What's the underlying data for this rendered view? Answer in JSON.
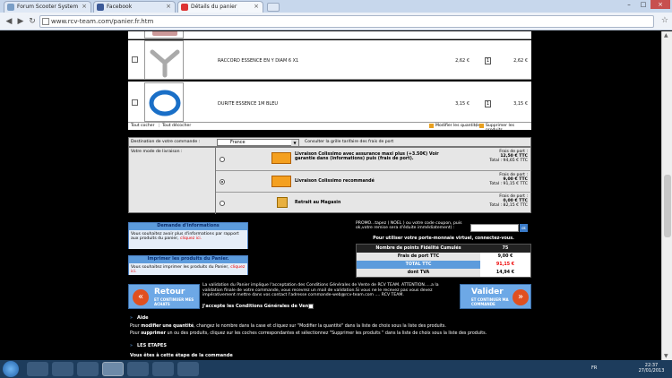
{
  "browser": {
    "tabs": [
      {
        "label": "Forum Scooter System"
      },
      {
        "label": "Facebook"
      },
      {
        "label": "Détails du panier"
      }
    ],
    "url": "www.rcv-team.com/panier.fr.htm"
  },
  "cart": {
    "items": [
      {
        "name": "RACCORD ESSENCE EN Y DIAM 6 X1",
        "unit_price": "2,62 €",
        "qty": "1",
        "total": "2,62 €"
      },
      {
        "name": "DURITE ESSENCE 1M BLEU",
        "unit_price": "3,15 €",
        "qty": "1",
        "total": "3,15 €"
      }
    ],
    "select_all": "Tout cocher",
    "deselect_all": "Tout décocher",
    "modify_qty": "Modifier les quantités",
    "remove_products": "Supprimer les produits"
  },
  "shipping": {
    "destination_label": "Destination de votre commande :",
    "country": "France",
    "grid_link": "Consulter la grille tarifaire des frais de port",
    "mode_label": "Votre mode de livraison :",
    "options": [
      {
        "name": "Livraison Colissimo avec assurance maxi plus (+3.50€) Voir garantie dans (informations) puis (frais de port).",
        "fee_label": "Frais de port :",
        "fee": "12,50 € TTC",
        "total": "Total : 94,65 € TTC"
      },
      {
        "name": "Livraison Colissimo recommandé",
        "fee_label": "Frais de port :",
        "fee": "9,00 € TTC",
        "total": "Total : 91,15 € TTC"
      },
      {
        "name": "Retrait au Magasin",
        "fee_label": "Frais de port :",
        "fee": "0,00 € TTC",
        "total": "Total : 82,15 € TTC"
      }
    ]
  },
  "info": {
    "request_title": "Demande d'informations",
    "request_text": "Vous souhaitez avoir plus d'informations par rapport aux produits du panier,",
    "request_link": "cliquez ici.",
    "print_title": "Imprimer les produits du Panier.",
    "print_text": "Vous souhaitez imprimer les produits du Panier,",
    "print_link": "cliquez ici."
  },
  "promo": {
    "text": "PROMO...tapez ( NOEL ) ou votre code coupon, puis ok,votre remise sera d'éduite immédiatement) :",
    "ok": "ok",
    "wallet_text": "Pour utiliser votre porte-monnaie virtuel, connectez-vous."
  },
  "summary": {
    "rows": [
      {
        "label": "Nombre de points Fidélité Cumulés",
        "value": "75"
      },
      {
        "label": "Frais de port TTC",
        "value": "9,00 €"
      },
      {
        "label": "TOTAL TTC",
        "value": "91,15 €"
      },
      {
        "label": "dont TVA",
        "value": "14,94 €"
      }
    ]
  },
  "actions": {
    "back_title": "Retour",
    "back_sub": "ET CONTINUER MES ACHATS",
    "validate_title": "Valider",
    "validate_sub": "ET CONTINUER MA COMMANDE",
    "cgv_text": "La validation du Panier implique l'acceptation des Conditions Générales de Vente de RCV TEAM. ATTENTION.....a la validation finale de votre commande, vous recevrez un mail de validation.Si vous ne le recevez pas vous devez impérativement mettre dans vos contact l'adresse commande-web@rcv-team.com .... RCV TEAM.",
    "accept_label": "J'accepte les Conditions Générales de Vente"
  },
  "help": {
    "title": "Aide",
    "line1_pre": "Pour",
    "line1_bold": "modifier une quantité",
    "line1_post": ", changez le nombre dans la case et cliquez sur \"Modifier la quantité\" dans la liste de choix sous la liste des produits.",
    "line2_pre": "Pour",
    "line2_bold": "supprimer",
    "line2_post": "un ou des produits, cliquez sur les coches correspondantes et sélectionnez \"Supprimer les produits \" dans la liste de choix sous la liste des produits.",
    "steps_title": "LES ETAPES",
    "step_text": "Vous êtes à cette étape de la commande"
  },
  "taskbar": {
    "lang": "FR",
    "time": "22:37",
    "date": "27/01/2013"
  },
  "colors": {
    "accent_blue": "#5c9bdc",
    "total_red": "#e00000"
  }
}
